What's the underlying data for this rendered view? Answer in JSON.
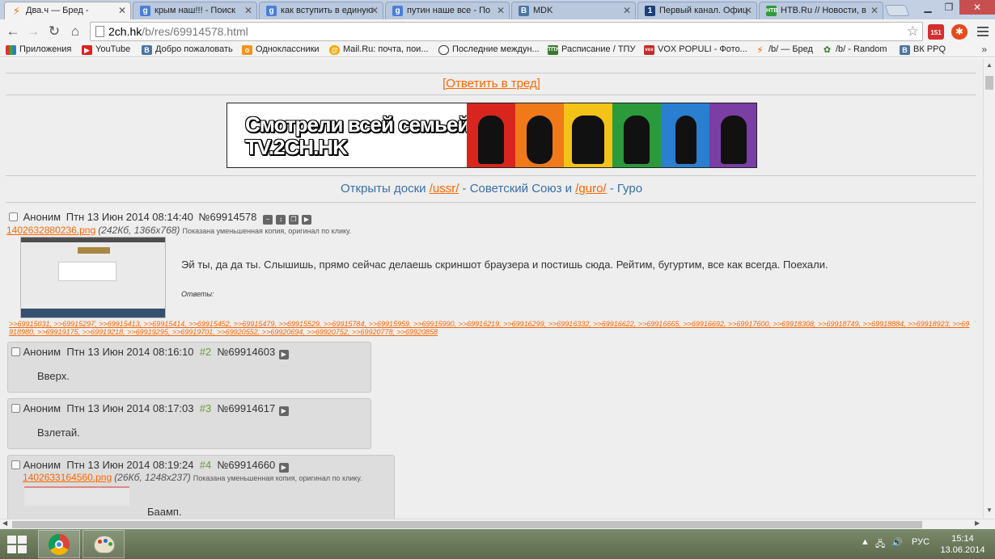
{
  "browser": {
    "tabs": [
      {
        "label": "Два.ч — Бред -",
        "icon": "twoch-bolt-icon",
        "active": true
      },
      {
        "label": "крым наш!!! - Поиск",
        "icon": "google-icon"
      },
      {
        "label": "как вступить в единую",
        "icon": "google-icon"
      },
      {
        "label": "путин наше все - По",
        "icon": "google-icon"
      },
      {
        "label": "MDK",
        "icon": "vk-icon"
      },
      {
        "label": "Первый канал. Офиц",
        "icon": "channel-one-icon"
      },
      {
        "label": "НТВ.Ru // Новости, в",
        "icon": "ntv-icon"
      }
    ],
    "url_host": "2ch.hk",
    "url_path": "/b/res/69914578.html",
    "ext_badge": "151",
    "bookmarks": [
      {
        "label": "Приложения",
        "icon": "apps-grid-icon"
      },
      {
        "label": "YouTube",
        "icon": "youtube-icon"
      },
      {
        "label": "Добро пожаловать",
        "icon": "vk-icon"
      },
      {
        "label": "Одноклассники",
        "icon": "odnoklassniki-icon"
      },
      {
        "label": "Mail.Ru: почта, пои...",
        "icon": "mailru-icon"
      },
      {
        "label": "Последние междун...",
        "icon": "circle-icon"
      },
      {
        "label": "Расписание / ТПУ",
        "icon": "tpu-icon"
      },
      {
        "label": "VOX POPULI - Фото...",
        "icon": "vox-icon"
      },
      {
        "label": "/b/ — Бред",
        "icon": "twoch-bolt-icon"
      },
      {
        "label": "/b/ - Random",
        "icon": "random-icon"
      },
      {
        "label": "ВК PPQ",
        "icon": "vk-icon"
      }
    ]
  },
  "thread": {
    "reply_link": "[Ответить в тред]",
    "banner_line1": "Смотрели всей семьей",
    "banner_line2": "TV.2CH.HK",
    "boards_note": {
      "prefix": "Открыты доски ",
      "board1": "/ussr/",
      "mid": " - Советский Союз и ",
      "board2": "/guro/",
      "suffix": " - Гуро"
    },
    "op": {
      "author": "Аноним",
      "date": "Птн 13 Июн 2014 08:14:40",
      "number": "№69914578",
      "filename": "1402632880236.png",
      "filemeta": "(242Кб, 1366x768)",
      "filenote": "Показана уменьшенная копия, оригинал по клику.",
      "text": "Эй ты, да да ты. Слышишь, прямо сейчас делаешь скриншот браузера и постишь сюда. Рейтим, бугуртим, все как всегда. Поехали.",
      "answers_label": "Ответы:",
      "reply_links": ">>69915031, >>69915297, >>69915413, >>69915414, >>69915452, >>69915479, >>69915529, >>69915784, >>69915959, >>69915990, >>69916219, >>69916299, >>69916332, >>69916622, >>69916665, >>69916692, >>69917600, >>69918308, >>69918749, >>69918884, >>69918923, >>69918980, >>69919175, >>69919218, >>69919295, >>69919701, >>69920552, >>69920694, >>69920752, >>69920778, >>69920858"
    },
    "posts": [
      {
        "author": "Аноним",
        "date": "Птн 13 Июн 2014 08:16:10",
        "ord": "#2",
        "number": "№69914603",
        "text": "Вверх."
      },
      {
        "author": "Аноним",
        "date": "Птн 13 Июн 2014 08:17:03",
        "ord": "#3",
        "number": "№69914617",
        "text": "Взлетай."
      },
      {
        "author": "Аноним",
        "date": "Птн 13 Июн 2014 08:19:24",
        "ord": "#4",
        "number": "№69914660",
        "filename": "1402633164560.png",
        "filemeta": "(26Кб, 1248x237)",
        "filenote": "Показана уменьшенная копия, оригинал по клику.",
        "text": "Баамп."
      }
    ]
  },
  "taskbar": {
    "lang": "РУС",
    "time": "15:14",
    "date": "13.06.2014"
  }
}
